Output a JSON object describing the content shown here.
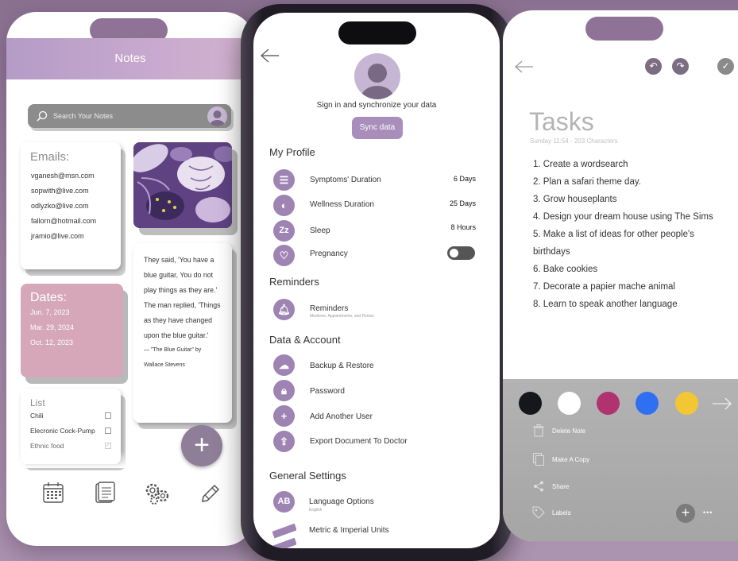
{
  "notes_phone": {
    "title": "Notes",
    "search_placeholder": "Search Your Notes",
    "emails_card": {
      "title": "Emails:",
      "items": [
        "vganesh@msn.com",
        "sopwith@live.com",
        "odlyzko@live.com",
        "fallorn@hotmail.com",
        "jramio@live.com"
      ]
    },
    "dates_card": {
      "title": "Dates:",
      "items": [
        "Jun. 7, 2023",
        "Mar. 29, 2024",
        "Oct. 12, 2023"
      ]
    },
    "quote_card": {
      "lines": [
        "They said, 'You have a",
        "blue guitar, You do not",
        "play things as they are.'",
        "The man replied, 'Things",
        "as they have changed",
        "upon the blue guitar.'",
        "— \"The Blue Guitar\" by",
        "Wallace Stevens"
      ]
    },
    "list_card": {
      "title": "List",
      "items": [
        {
          "label": "Chili",
          "checked": false
        },
        {
          "label": "Elecronic Cock-Pump",
          "checked": false
        },
        {
          "label": "Ethnic food",
          "checked": true
        }
      ]
    },
    "fab_label": "+",
    "colors": {
      "header": "#c0a3cb",
      "dates": "#d5a7b8",
      "fab": "#8e7e97"
    }
  },
  "profile_phone": {
    "sign_in_text": "Sign in and synchronize your data",
    "sync_button": "Sync data",
    "sections": {
      "my_profile": "My Profile",
      "reminders": "Reminders",
      "data_account": "Data & Account",
      "general": "General Settings"
    },
    "profile_items": [
      {
        "label": "Symptoms' Duration",
        "value": "6 Days"
      },
      {
        "label": "Wellness Duration",
        "value": "25 Days"
      },
      {
        "label": "Sleep",
        "value": "8 Hours"
      },
      {
        "label": "Pregnancy",
        "toggle": false
      }
    ],
    "reminder_item": {
      "label": "Reminders",
      "sub": "Medicine, Appointments, and Period."
    },
    "data_items": [
      "Backup & Restore",
      "Password",
      "Add Another User",
      "Export Document To Doctor"
    ],
    "general_items": [
      {
        "label": "Language Options",
        "sub": "English",
        "icon_text": "AB"
      },
      {
        "label": "Metric & Imperial Units"
      }
    ],
    "colors": {
      "accent": "#9d84b2",
      "button": "#a98ebb"
    }
  },
  "tasks_phone": {
    "title": "Tasks",
    "subtitle": "Sunday 11:54 - 203 Characters",
    "tasks": [
      "1. Create a wordsearch",
      "2. Plan a safari theme day.",
      "3. Grow houseplants",
      "4. Design your dream house using The Sims",
      "5. Make a list of ideas for other people's",
      "birthdays",
      "6. Bake cookies",
      "7. Decorate a papier mache animal",
      "8. Learn to speak another language"
    ],
    "swatches": [
      "#15171c",
      "#ffffff",
      "#b0336f",
      "#2f6ff2",
      "#f3c733"
    ],
    "menu": [
      "Delete Note",
      "Make A Copy",
      "Share",
      "Labels"
    ],
    "add_label": "+",
    "more_label": "•••"
  }
}
